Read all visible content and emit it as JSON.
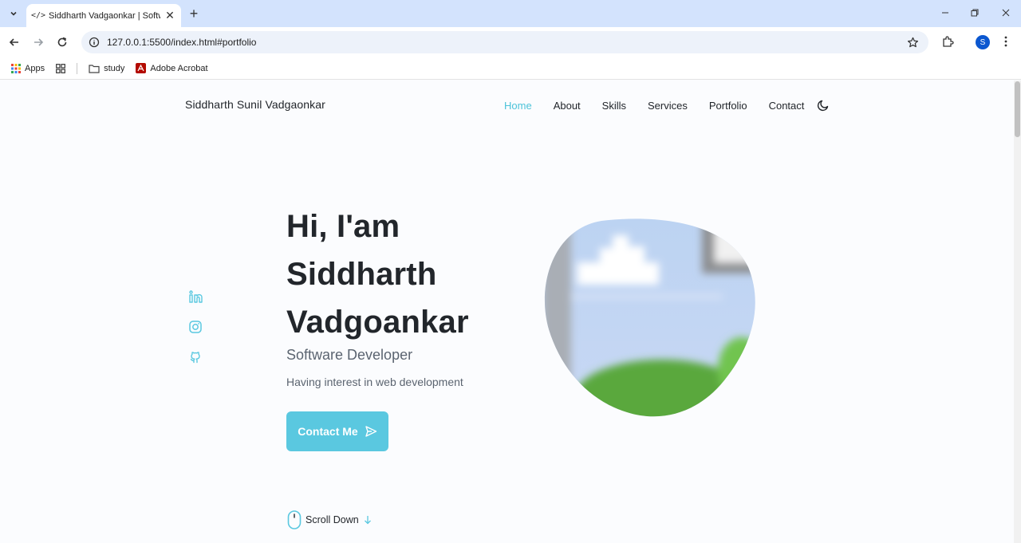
{
  "browser": {
    "tab_title": "Siddharth Vadgaonkar | Software Developer",
    "tab_favicon": "</>",
    "url": "127.0.0.1:5500/index.html#portfolio",
    "profile_initial": "S",
    "bookmarks": [
      {
        "label": "Apps",
        "icon": "apps-grid-icon"
      },
      {
        "label": "study",
        "icon": "folder-icon"
      },
      {
        "label": "Adobe Acrobat",
        "icon": "acrobat-icon"
      }
    ]
  },
  "site": {
    "logo": "Siddharth Sunil Vadgaonkar",
    "nav": [
      {
        "label": "Home",
        "active": true
      },
      {
        "label": "About"
      },
      {
        "label": "Skills"
      },
      {
        "label": "Services"
      },
      {
        "label": "Portfolio"
      },
      {
        "label": "Contact"
      }
    ],
    "socials": [
      "linkedin-icon",
      "instagram-icon",
      "github-icon"
    ]
  },
  "hero": {
    "title_line1": "Hi, I'am",
    "title_line2": "Siddharth",
    "title_line3": "Vadgoankar",
    "subtitle": "Software Developer",
    "description": "Having interest in web development",
    "button_label": "Contact Me",
    "scroll_label": "Scroll Down"
  },
  "colors": {
    "accent": "#5ac8e0",
    "nav_active": "#4cc3d9",
    "text": "#22262b",
    "muted": "#5b6470"
  }
}
